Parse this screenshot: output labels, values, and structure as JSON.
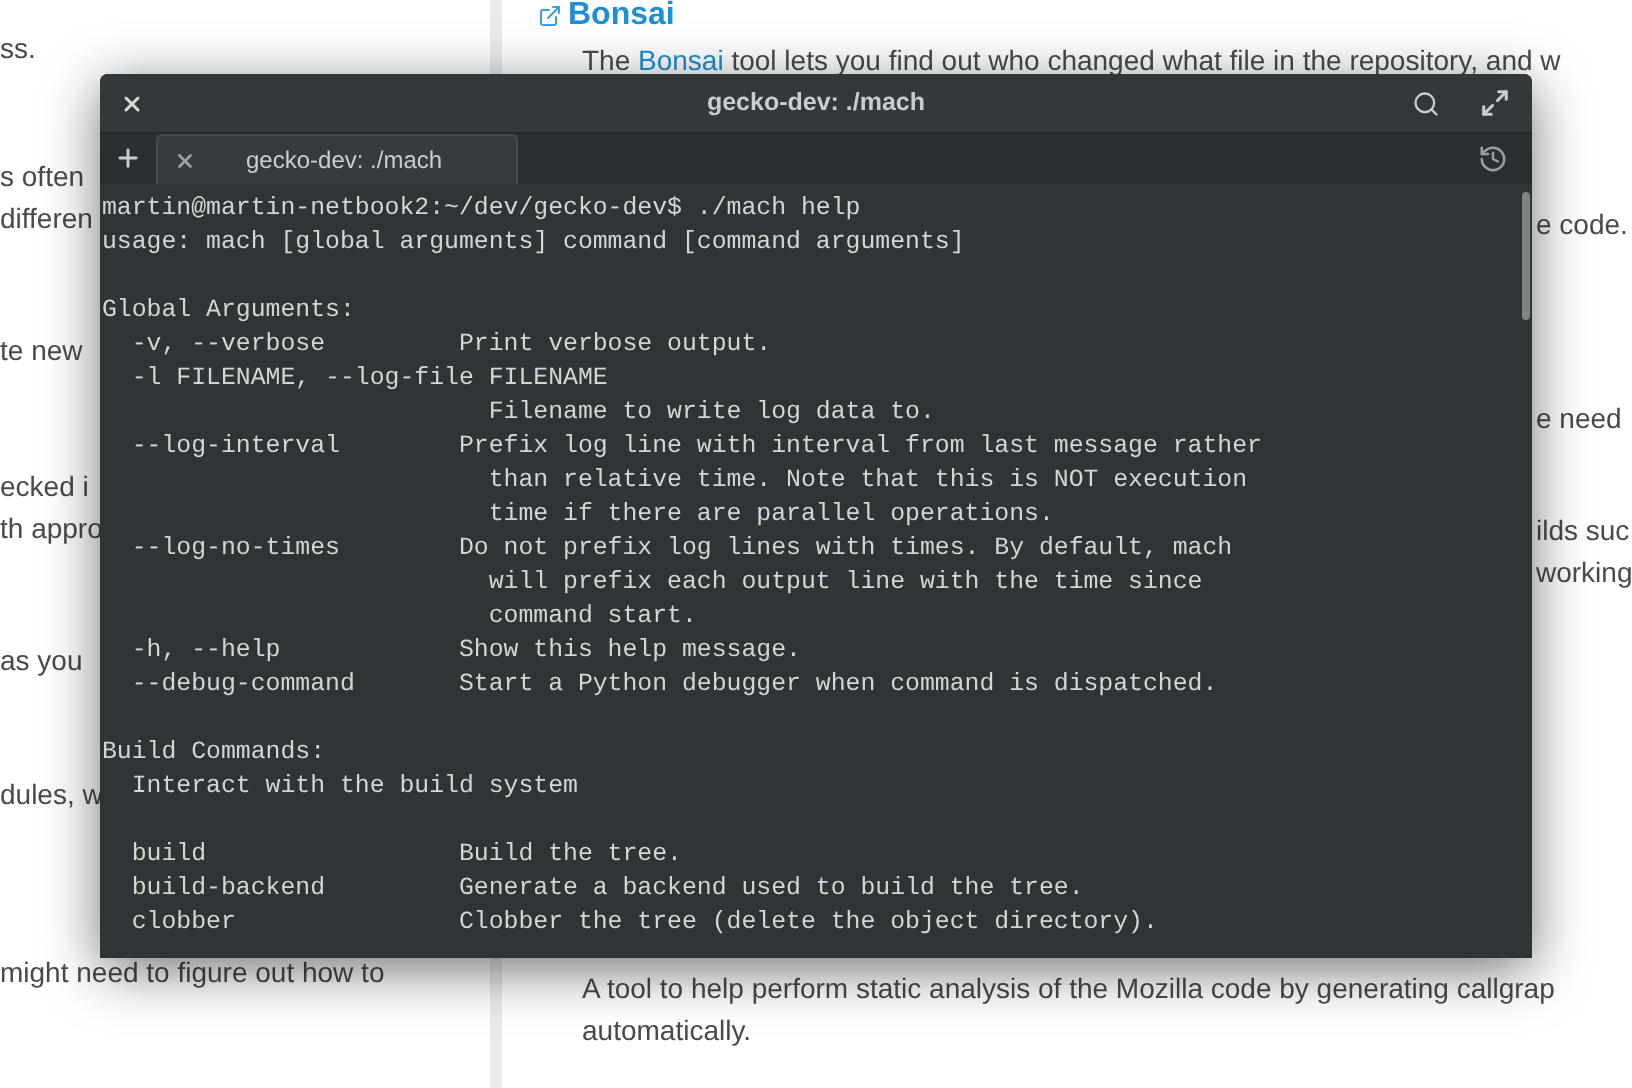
{
  "page": {
    "left_paragraphs": [
      [
        "ss."
      ],
      [
        "s often",
        "differen"
      ],
      [
        "te new"
      ],
      [
        "ecked i",
        "th appro"
      ],
      [
        "as you"
      ],
      [
        "dules, w"
      ],
      [
        "might need to figure out how to"
      ]
    ],
    "right": {
      "heading": "Bonsai",
      "intro_before": "The ",
      "intro_link": "Bonsai",
      "intro_after": " tool lets you find out who changed what file in the repository, and w",
      "edge_fragments": [
        "e code.",
        "e need",
        "ilds suc",
        "working"
      ],
      "bottom_lines": [
        "A tool to help perform static analysis of the Mozilla code by generating callgrap",
        "automatically."
      ]
    }
  },
  "terminal": {
    "title": "gecko-dev: ./mach",
    "tabs": [
      {
        "label": "gecko-dev: ./mach",
        "selected": true
      }
    ],
    "blocks": [
      {
        "lines": [
          {
            "text": "martin@martin-netbook2:~/dev/gecko-dev$ ./mach help"
          },
          {
            "text": "usage: mach [global arguments] command [command arguments]"
          }
        ]
      },
      {
        "lines": [
          {
            "text": "Global Arguments:"
          },
          {
            "text": "  -v, --verbose         Print verbose output."
          },
          {
            "text": "  -l FILENAME, --log-file FILENAME"
          },
          {
            "text": "                          Filename to write log data to."
          },
          {
            "text": "  --log-interval        Prefix log line with interval from last message rather"
          },
          {
            "text": "                          than relative time. Note that this is NOT execution"
          },
          {
            "text": "                          time if there are parallel operations."
          },
          {
            "text": "  --log-no-times        Do not prefix log lines with times. By default, mach"
          },
          {
            "text": "                          will prefix each output line with the time since"
          },
          {
            "text": "                          command start."
          },
          {
            "text": "  -h, --help            Show this help message."
          },
          {
            "text": "  --debug-command       Start a Python debugger when command is dispatched."
          }
        ]
      },
      {
        "lines": [
          {
            "text": "Build Commands:"
          },
          {
            "text": "  Interact with the build system"
          }
        ]
      },
      {
        "lines": [
          {
            "text": "  build                 Build the tree."
          },
          {
            "text": "  build-backend         Generate a backend used to build the tree."
          },
          {
            "text": "  clobber               Clobber the tree (delete the object directory)."
          }
        ]
      }
    ]
  }
}
